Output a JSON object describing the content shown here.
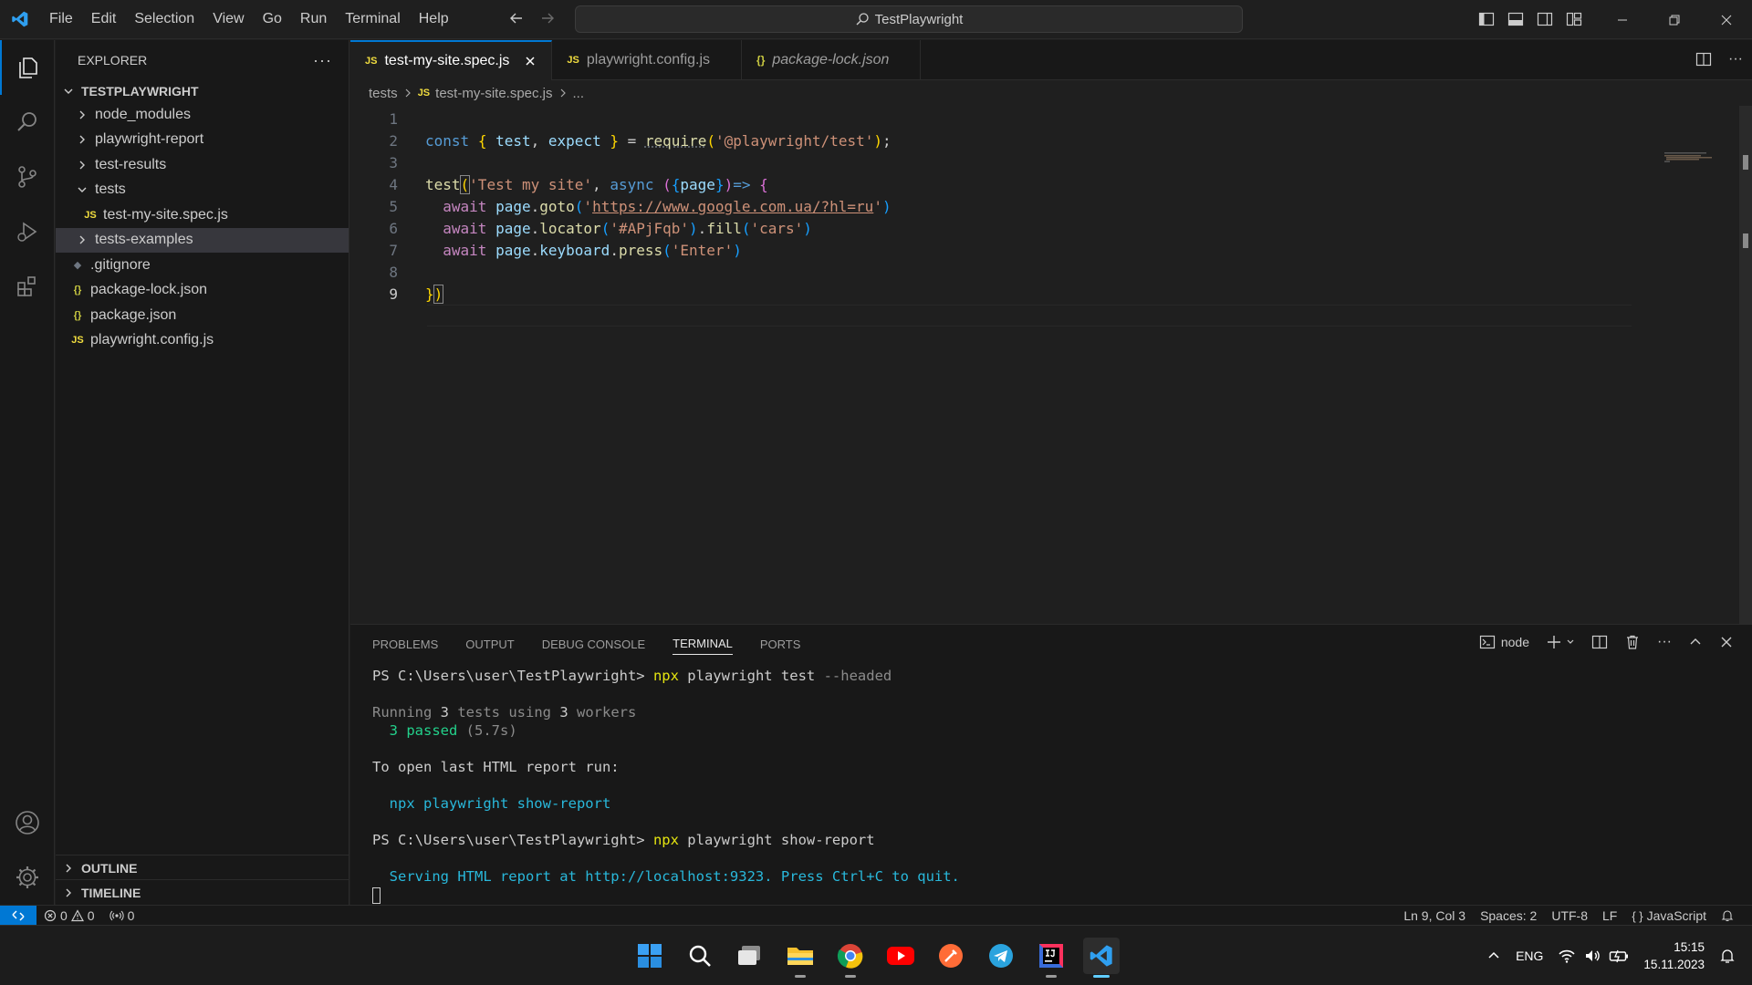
{
  "titlebar": {
    "menu": [
      "File",
      "Edit",
      "Selection",
      "View",
      "Go",
      "Run",
      "Terminal",
      "Help"
    ],
    "search_text": "TestPlaywright"
  },
  "sidebar": {
    "header": "EXPLORER",
    "root": "TESTPLAYWRIGHT",
    "items": [
      {
        "label": "node_modules",
        "type": "folder",
        "expanded": false,
        "depth": 1
      },
      {
        "label": "playwright-report",
        "type": "folder",
        "expanded": false,
        "depth": 1
      },
      {
        "label": "test-results",
        "type": "folder",
        "expanded": false,
        "depth": 1
      },
      {
        "label": "tests",
        "type": "folder",
        "expanded": true,
        "depth": 1
      },
      {
        "label": "test-my-site.spec.js",
        "type": "js",
        "depth": 2
      },
      {
        "label": "tests-examples",
        "type": "folder",
        "expanded": false,
        "depth": 1,
        "selected": true
      },
      {
        "label": ".gitignore",
        "type": "git",
        "depth": 1
      },
      {
        "label": "package-lock.json",
        "type": "json",
        "depth": 1
      },
      {
        "label": "package.json",
        "type": "json",
        "depth": 1
      },
      {
        "label": "playwright.config.js",
        "type": "js",
        "depth": 1
      }
    ],
    "outline": "OUTLINE",
    "timeline": "TIMELINE"
  },
  "tabs": [
    {
      "label": "test-my-site.spec.js",
      "icon": "JS",
      "active": true
    },
    {
      "label": "playwright.config.js",
      "icon": "JS",
      "active": false
    },
    {
      "label": "package-lock.json",
      "icon": "{}",
      "active": false,
      "italic": true
    }
  ],
  "breadcrumb": {
    "folder": "tests",
    "file": "test-my-site.spec.js",
    "tail": "..."
  },
  "code": {
    "line_numbers": [
      "1",
      "2",
      "3",
      "4",
      "5",
      "6",
      "7",
      "8",
      "9"
    ],
    "l2": {
      "a": "const",
      "b": "{",
      "c": "test",
      "d": ",",
      "e": "expect",
      "f": "}",
      "g": "=",
      "h": "require",
      "i": "(",
      "j": "'@playwright/test'",
      "k": ")",
      "l": ";"
    },
    "l4": {
      "a": "test",
      "b": "(",
      "c": "'Test my site'",
      "d": ",",
      "e": "async",
      "f": "(",
      "g": "{",
      "h": "page",
      "i": "}",
      "j": ")",
      "k": "=>",
      "l": "{"
    },
    "l5": {
      "a": "await",
      "b": "page",
      "c": ".",
      "d": "goto",
      "e": "(",
      "f": "'",
      "g": "https://www.google.com.ua/?hl=ru",
      "h": "'",
      "i": ")"
    },
    "l6": {
      "a": "await",
      "b": "page",
      "c": ".",
      "d": "locator",
      "e": "(",
      "f": "'#APjFqb'",
      "g": ")",
      "h": ".",
      "i": "fill",
      "j": "(",
      "k": "'cars'",
      "l": ")"
    },
    "l7": {
      "a": "await",
      "b": "page",
      "c": ".",
      "d": "keyboard",
      "e": ".",
      "f": "press",
      "g": "(",
      "h": "'Enter'",
      "i": ")"
    },
    "l9": {
      "a": "}",
      "b": ")"
    }
  },
  "panel": {
    "tabs": [
      "PROBLEMS",
      "OUTPUT",
      "DEBUG CONSOLE",
      "TERMINAL",
      "PORTS"
    ],
    "active_tab": "TERMINAL",
    "shell": "node",
    "terminal": {
      "prompt1": "PS C:\\Users\\user\\TestPlaywright> ",
      "cmd1a": "npx",
      "cmd1b": " playwright test ",
      "cmd1c": "--headed",
      "run_a": "Running ",
      "run_b": "3",
      "run_c": " tests using ",
      "run_d": "3",
      "run_e": " workers",
      "passed_a": "  3 passed",
      "passed_b": " (5.7s)",
      "open_report": "To open last HTML report run:",
      "show_report": "  npx playwright show-report",
      "prompt2": "PS C:\\Users\\user\\TestPlaywright> ",
      "cmd2a": "npx",
      "cmd2b": " playwright show-report",
      "serving": "  Serving HTML report at http://localhost:9323. Press Ctrl+C to quit."
    }
  },
  "statusbar": {
    "errors": "0",
    "warnings": "0",
    "ports": "0",
    "position": "Ln 9, Col 3",
    "spaces": "Spaces: 2",
    "encoding": "UTF-8",
    "eol": "LF",
    "language": "JavaScript"
  },
  "taskbar": {
    "apps": [
      "start-icon",
      "search-icon",
      "task-view-icon",
      "file-explorer-icon",
      "chrome-icon",
      "youtube-icon",
      "postman-icon",
      "telegram-icon",
      "intellij-icon",
      "vscode-icon"
    ],
    "lang": "ENG",
    "time": "15:15",
    "date": "15.11.2023"
  },
  "colors": {
    "accent": "#0078d4",
    "background": "#1f1f1f",
    "sidebar": "#181818"
  }
}
